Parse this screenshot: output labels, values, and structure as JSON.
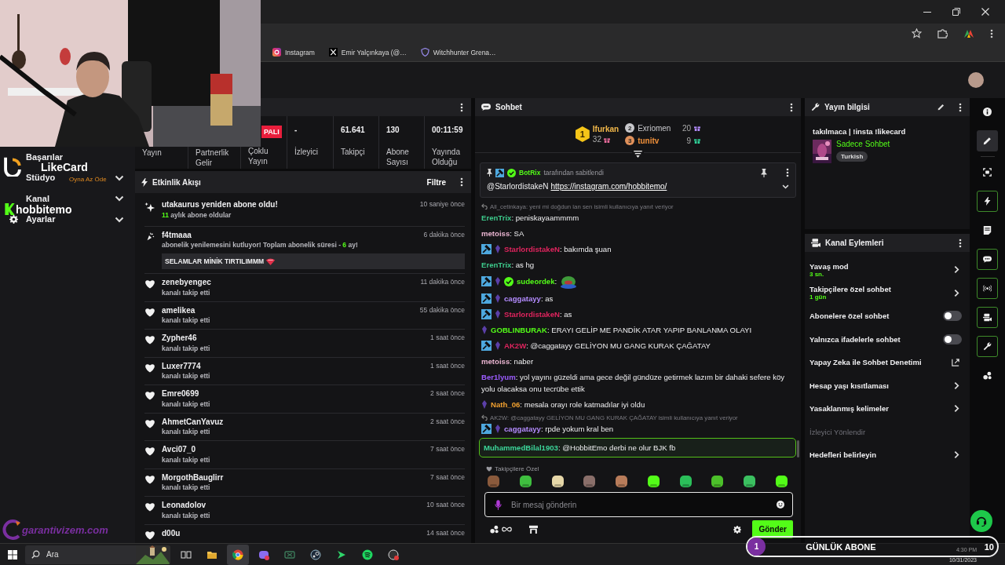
{
  "browser": {
    "bookmarks": [
      {
        "kind": "instagram",
        "label": "Instagram"
      },
      {
        "kind": "x",
        "label": "Emir Yalçınkaya (@…"
      },
      {
        "kind": "shield",
        "label": "Witchhunter Grena…"
      }
    ]
  },
  "sidebar": {
    "items": [
      {
        "label": "Başarılar"
      },
      {
        "label": "Stüdyo",
        "expanded": false
      },
      {
        "label": "Kanal",
        "expanded": false
      },
      {
        "label": "Ayarlar",
        "kind": "settings",
        "expanded": false
      }
    ]
  },
  "stats": [
    {
      "label": "Yayın"
    },
    {
      "label": "Partnerlik Gelir"
    },
    {
      "label": "Çoklu Yayın",
      "value": "PALI",
      "kind": "badge"
    },
    {
      "label": "İzleyici",
      "value": "-"
    },
    {
      "label": "Takipçi",
      "value": "61.641"
    },
    {
      "label": "Abone Sayısı",
      "value": "130"
    },
    {
      "label": "Yayında Olduğu",
      "value": "00:11:59"
    }
  ],
  "activity": {
    "title": "Etkinlik Akışı",
    "filter": "Filtre",
    "items": [
      {
        "kind": "resub",
        "title": "utakaurus yeniden abone oldu!",
        "detail": "**11** aylık abone oldular",
        "time": "10 saniye önce"
      },
      {
        "kind": "resub_message",
        "title": "f4tmaaa",
        "detail": "abonelik yenilemesini kutluyor! Toplam abonelik süresi - **6** ay!",
        "message": "SELAMLAR MİNİK TIRTILIMMM",
        "time": "6 dakika önce"
      },
      {
        "kind": "follow",
        "title": "zenebyengec",
        "detail": "kanalı takip etti",
        "time": "11 dakika önce"
      },
      {
        "kind": "follow",
        "title": "amelikea",
        "detail": "kanalı takip etti",
        "time": "55 dakika önce"
      },
      {
        "kind": "follow",
        "title": "Zypher46",
        "detail": "kanalı takip etti",
        "time": "1 saat önce"
      },
      {
        "kind": "follow",
        "title": "Luxer7774",
        "detail": "kanalı takip etti",
        "time": "1 saat önce"
      },
      {
        "kind": "follow",
        "title": "Emre0699",
        "detail": "kanalı takip etti",
        "time": "2 saat önce"
      },
      {
        "kind": "follow",
        "title": "AhmetCanYavuz",
        "detail": "kanalı takip etti",
        "time": "2 saat önce"
      },
      {
        "kind": "follow",
        "title": "Avci07_0",
        "detail": "kanalı takip etti",
        "time": "7 saat önce"
      },
      {
        "kind": "follow",
        "title": "MorgothBauglirr",
        "detail": "kanalı takip etti",
        "time": "7 saat önce"
      },
      {
        "kind": "follow",
        "title": "Leonadolov",
        "detail": "kanalı takip etti",
        "time": "10 saat önce"
      },
      {
        "kind": "follow",
        "title": "d00u",
        "time": "14 saat önce"
      }
    ]
  },
  "chat": {
    "title": "Sohbet",
    "leaders": [
      {
        "rank": "1",
        "name": "Ifurkan",
        "count": "32"
      },
      {
        "rank": "2",
        "name": "Exriomen",
        "count": "20"
      },
      {
        "rank": "3",
        "name": "tunitv",
        "count": "9"
      }
    ],
    "pinned": {
      "pinned_by": "BotRix",
      "pinned_note": "tarafından sabitlendi",
      "mention": "@StarlordistakeN",
      "link": "https://instagram.com/hobbitemo/"
    },
    "messages": [
      {
        "reply_to": "All_cetinkaya: yeni mi doğdun lan sen isimli kullanıcıya yanıt veriyor",
        "user": "ErenTrix",
        "color": "#3cc88a",
        "text": ": peniskayaammmm"
      },
      {
        "user": "metoiss",
        "color": "#e8b3cf",
        "text": ": SA"
      },
      {
        "badges": [
          {
            "kind": "mod"
          },
          {
            "kind": "gem"
          }
        ],
        "user": "StarlordistakeN",
        "color": "#e0245e",
        "text": ": bakımda şuan"
      },
      {
        "user": "ErenTrix",
        "color": "#3cc88a",
        "text": ": as hg"
      },
      {
        "badges": [
          {
            "kind": "mod"
          },
          {
            "kind": "gem"
          },
          {
            "kind": "verified"
          }
        ],
        "user": "sudeordek",
        "color": "#53fc18",
        "text": ":",
        "emote": true
      },
      {
        "badges": [
          {
            "kind": "mod"
          },
          {
            "kind": "gem"
          }
        ],
        "user": "caggatayy",
        "color": "#b48cff",
        "text": ": as"
      },
      {
        "badges": [
          {
            "kind": "mod"
          },
          {
            "kind": "gem"
          }
        ],
        "user": "StarlordistakeN",
        "color": "#e0245e",
        "text": ": as"
      },
      {
        "badges": [
          {
            "kind": "gem"
          }
        ],
        "user": "GOBLINBURAK",
        "color": "#53fc18",
        "text": ": ERAYI GELİP ME PANDİK ATAR YAPIP BANLANMA OLAYI"
      },
      {
        "badges": [
          {
            "kind": "mod"
          },
          {
            "kind": "gem"
          }
        ],
        "user": "AK2W",
        "color": "#e0245e",
        "text": ": @caggatayy GELİYON MU GANG KURAK ÇAĞATAY"
      },
      {
        "user": "metoiss",
        "color": "#e8b3cf",
        "text": ": naber"
      },
      {
        "user": "Ber1lyum",
        "color": "#9b5cff",
        "text": ": yol yayını güzeldi ama gece değil gündüze getirmek lazım bir dahaki sefere köy yolu olacaksa onu tecrübe ettik"
      },
      {
        "badges": [
          {
            "kind": "gem"
          }
        ],
        "user": "Nath_06",
        "color": "#f0a030",
        "text": ": mesala orayı role katmadılar iyi oldu"
      },
      {
        "reply_to": "AK2W: @caggatayy GELİYON MU GANG KURAK ÇAĞATAY isimli kullanıcıya yanıt veriyor",
        "badges": [
          {
            "kind": "mod"
          },
          {
            "kind": "gem"
          }
        ],
        "user": "caggatayy",
        "color": "#b48cff",
        "text": ": rpde yokum kral ben"
      },
      {
        "user": "MuhammedBilal1903",
        "color": "#3cd69a",
        "text": ": @HobbitEmo derbi ne olur BJK fb",
        "highlighted": true
      }
    ],
    "emote_section": "Takipçilere Özel",
    "emotes": [
      {
        "color": "#8a5a3c"
      },
      {
        "color": "#3fbf3f"
      },
      {
        "color": "#e6d7a8"
      },
      {
        "color": "#8a6f6a"
      },
      {
        "color": "#b87c5a"
      },
      {
        "color": "#53fc18"
      },
      {
        "color": "#2bbf5a"
      },
      {
        "color": "#4cc02a"
      },
      {
        "color": "#3bc060"
      },
      {
        "color": "#53fc18"
      }
    ],
    "input": {
      "placeholder": "Bir mesaj gönderin"
    },
    "send": "Gönder"
  },
  "stream_info": {
    "title": "Yayın bilgisi",
    "stream_title": "takılmaca | !insta !likecard",
    "category": "Sadece Sohbet",
    "tags": [
      "Turkish"
    ]
  },
  "channel_actions": {
    "title": "Kanal Eylemleri",
    "items": [
      {
        "kind": "link",
        "label": "Yavaş mod",
        "sub": "3 sn."
      },
      {
        "kind": "link",
        "label": "Takipçilere özel sohbet",
        "sub": "1 gün"
      },
      {
        "kind": "toggle",
        "label": "Abonelere özel sohbet",
        "on": false
      },
      {
        "kind": "toggle",
        "label": "Yalnızca ifadelerle sohbet",
        "on": false
      },
      {
        "kind": "external",
        "label": "Yapay Zeka ile Sohbet Denetimi"
      },
      {
        "kind": "link",
        "label": "Hesap yaşı kısıtlaması"
      },
      {
        "kind": "link",
        "label": "Yasaklanmış kelimeler"
      },
      {
        "kind": "label",
        "label": "İzleyici Yönlendir",
        "disabled": true
      },
      {
        "kind": "link",
        "label": "Hedefleri belirleyin"
      }
    ]
  },
  "rail": [
    {
      "kind": "info",
      "selected": false,
      "outlined": false
    },
    {
      "kind": "pencil",
      "selected": true,
      "outlined": false
    },
    {
      "kind": "divider"
    },
    {
      "kind": "capture",
      "selected": false,
      "outlined": false
    },
    {
      "kind": "bolt",
      "selected": false,
      "outlined": true
    },
    {
      "kind": "document",
      "selected": false,
      "outlined": false
    },
    {
      "kind": "chat",
      "selected": false,
      "outlined": true
    },
    {
      "kind": "broadcast",
      "selected": false,
      "outlined": true
    },
    {
      "kind": "camera",
      "selected": false,
      "outlined": true
    },
    {
      "kind": "wrench",
      "selected": false,
      "outlined": true
    },
    {
      "kind": "dots",
      "selected": false,
      "outlined": false
    }
  ],
  "taskbar": {
    "search": "Ara",
    "apps": [
      {
        "kind": "taskview",
        "selected": false
      },
      {
        "kind": "folder",
        "selected": false
      },
      {
        "kind": "browser",
        "selected": true
      },
      {
        "kind": "chat",
        "selected": false
      },
      {
        "kind": "console",
        "selected": false
      },
      {
        "kind": "steam",
        "selected": false
      },
      {
        "kind": "arrow",
        "selected": false
      },
      {
        "kind": "music",
        "selected": false
      },
      {
        "kind": "recorder",
        "selected": false
      }
    ],
    "time": "4:30 PM",
    "date": "10/31/2023"
  },
  "overlays": {
    "sponsor": {
      "name": "LikeCard",
      "tagline": "Oyna  Az Öde"
    },
    "channel_logo": "hobbitemo",
    "site_logo": "garantivizem.com",
    "sub_goal": {
      "count": "1",
      "label": "GÜNLÜK ABONE",
      "target": "10"
    }
  }
}
